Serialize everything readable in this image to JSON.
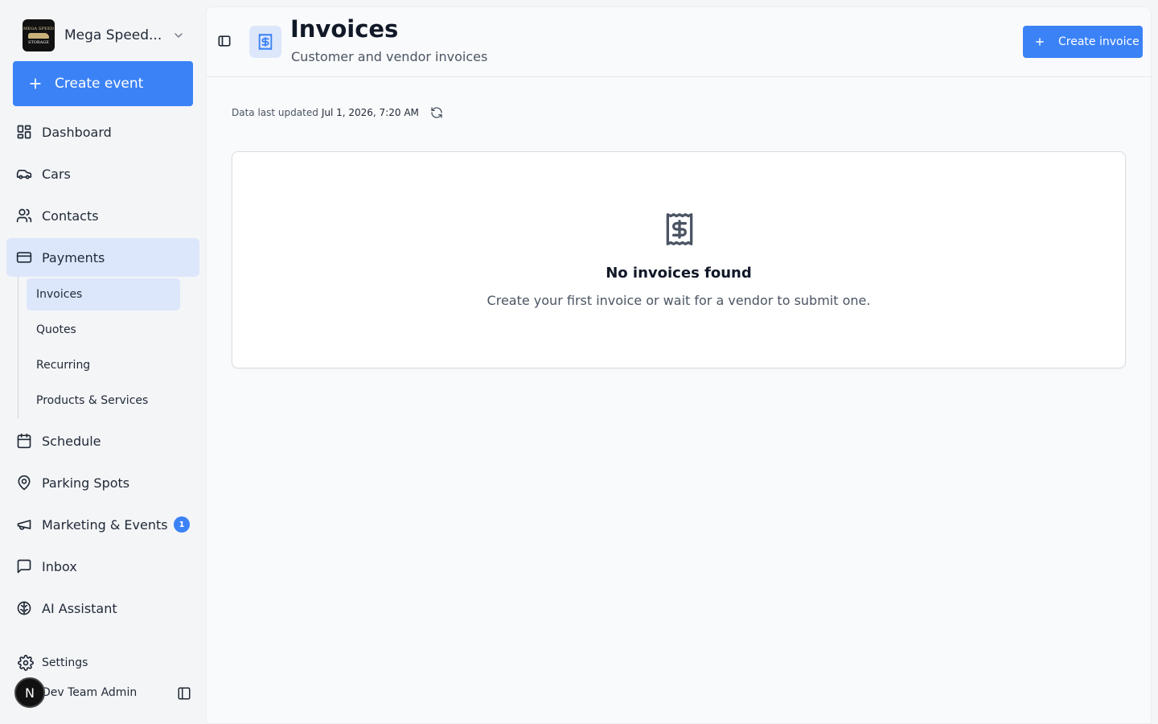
{
  "sidebar": {
    "org_name": "Mega Speed...",
    "org_logo_text_top": "MEGA SPEED",
    "org_logo_text_bottom": "STORAGE",
    "create_event_label": "Create event",
    "nav": [
      {
        "label": "Dashboard",
        "icon": "dashboard-icon"
      },
      {
        "label": "Cars",
        "icon": "car-icon"
      },
      {
        "label": "Contacts",
        "icon": "users-icon"
      },
      {
        "label": "Payments",
        "icon": "credit-card-icon"
      },
      {
        "label": "Schedule",
        "icon": "calendar-icon"
      },
      {
        "label": "Parking Spots",
        "icon": "map-pin-icon"
      },
      {
        "label": "Marketing & Events",
        "icon": "megaphone-icon",
        "badge": "1"
      },
      {
        "label": "Inbox",
        "icon": "message-square-icon"
      },
      {
        "label": "AI Assistant",
        "icon": "brain-icon"
      }
    ],
    "payments_sub": [
      {
        "label": "Invoices"
      },
      {
        "label": "Quotes"
      },
      {
        "label": "Recurring"
      },
      {
        "label": "Products & Services"
      }
    ],
    "settings_label": "Settings",
    "user_name": "Dev Team Admin",
    "avatar_initial": "N"
  },
  "header": {
    "title": "Invoices",
    "subtitle": "Customer and vendor invoices",
    "create_button": "Create invoice"
  },
  "status": {
    "updated_label": "Data last updated",
    "updated_value": "Jul 1, 2026, 7:20 AM"
  },
  "empty_state": {
    "title": "No invoices found",
    "description": "Create your first invoice or wait for a vendor to submit one."
  },
  "colors": {
    "accent": "#3b82f6",
    "active_bg": "#dde7fb"
  }
}
